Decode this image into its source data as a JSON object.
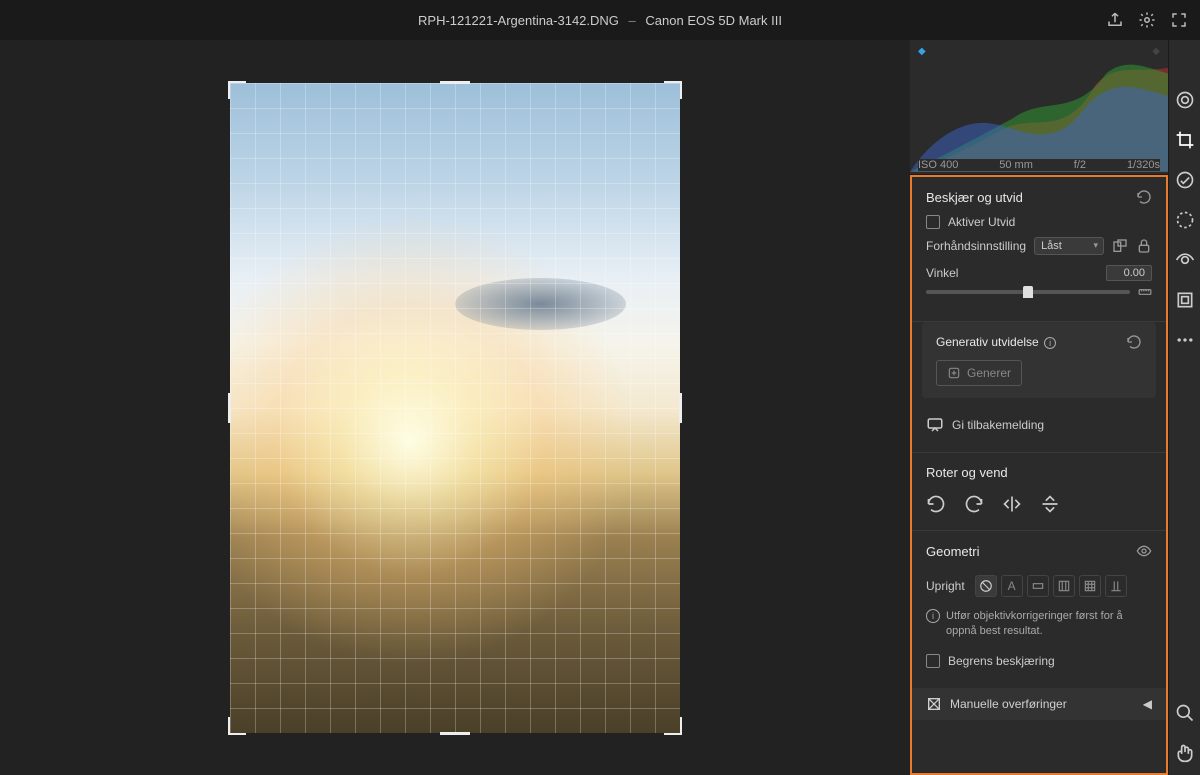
{
  "header": {
    "filename": "RPH-121221-Argentina-3142.DNG",
    "separator": "–",
    "camera": "Canon EOS 5D Mark III"
  },
  "meta": {
    "iso": "ISO 400",
    "focal": "50 mm",
    "aperture": "f/2",
    "shutter": "1/320s"
  },
  "crop": {
    "title": "Beskjær og utvid",
    "enable_expand": "Aktiver Utvid",
    "preset_label": "Forhåndsinnstilling",
    "preset_value": "Låst",
    "angle_label": "Vinkel",
    "angle_value": "0.00"
  },
  "gen": {
    "title": "Generativ utvidelse",
    "button": "Generer",
    "feedback": "Gi tilbakemelding"
  },
  "rotate": {
    "title": "Roter og vend"
  },
  "geometry": {
    "title": "Geometri",
    "upright_label": "Upright",
    "tip": "Utfør objektivkorrigeringer først for å oppnå best resultat.",
    "constrain": "Begrens beskjæring",
    "manual": "Manuelle overføringer"
  }
}
